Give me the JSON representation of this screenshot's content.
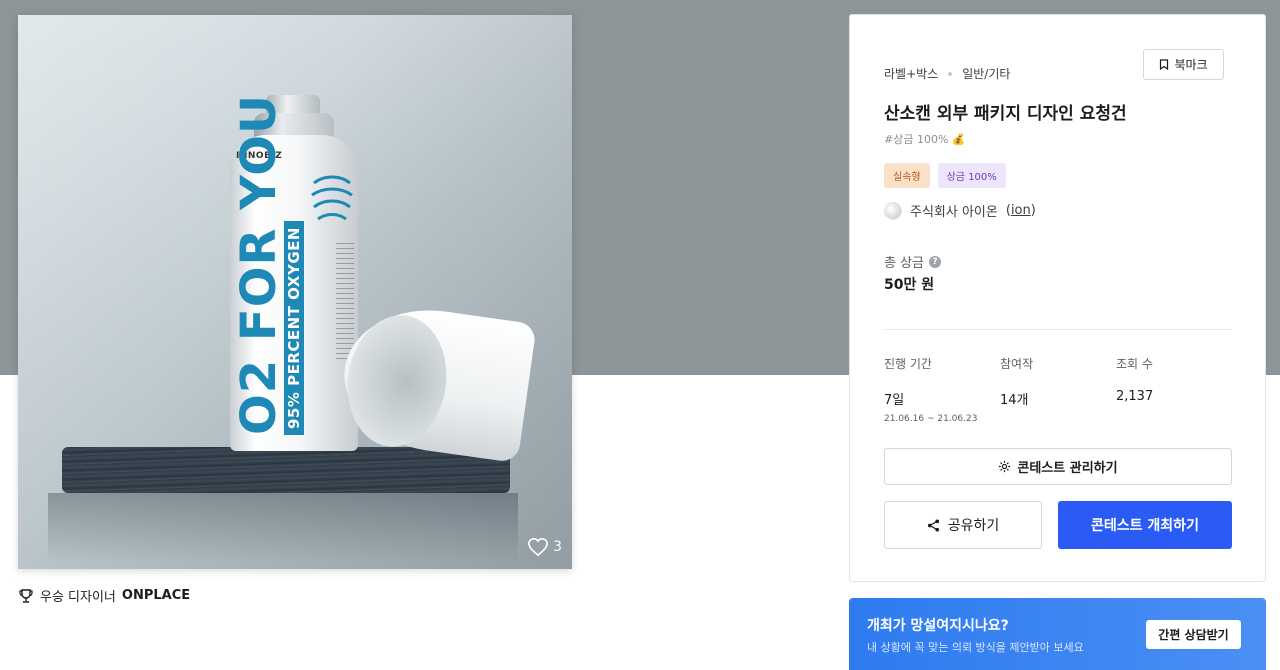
{
  "image": {
    "product_text_big": "O2 FOR YOU",
    "product_text_small": "95% PERCENT OXYGEN",
    "product_brand": "INNOBIZ",
    "like_count": "3"
  },
  "winner": {
    "prefix": "우승 디자이너",
    "name": "ONPLACE"
  },
  "card": {
    "category_main": "라벨+박스",
    "category_sub": "일반/기타",
    "bookmark_label": "북마크",
    "title": "산소캔 외부 패키지 디자인 요청건",
    "hashtag": "#상금 100% 💰",
    "badges": [
      "실속형",
      "상금 100%"
    ],
    "host_name": "주식회사 아이온",
    "host_handle": "ion",
    "prize_label": "총 상금",
    "prize_value": "50만 원",
    "stats": {
      "period_label": "진행 기간",
      "period_value": "7일",
      "period_range": "21.06.16 ~ 21.06.23",
      "entries_label": "참여작",
      "entries_value": "14개",
      "views_label": "조회 수",
      "views_value": "2,137"
    },
    "manage_label": "콘테스트 관리하기",
    "share_label": "공유하기",
    "open_label": "콘테스트 개최하기"
  },
  "consult": {
    "question": "개최가 망설여지시나요?",
    "subtext": "내 상황에 꼭 맞는 의뢰 방식을 제안받아 보세요",
    "button_label": "간편 상담받기"
  },
  "colors": {
    "top_band": "#8d9599",
    "primary": "#2a5cf5",
    "consult_bg": "#2e7bf0",
    "badge_orange_bg": "#fbe1c8",
    "badge_purple_bg": "#ece5fb"
  }
}
